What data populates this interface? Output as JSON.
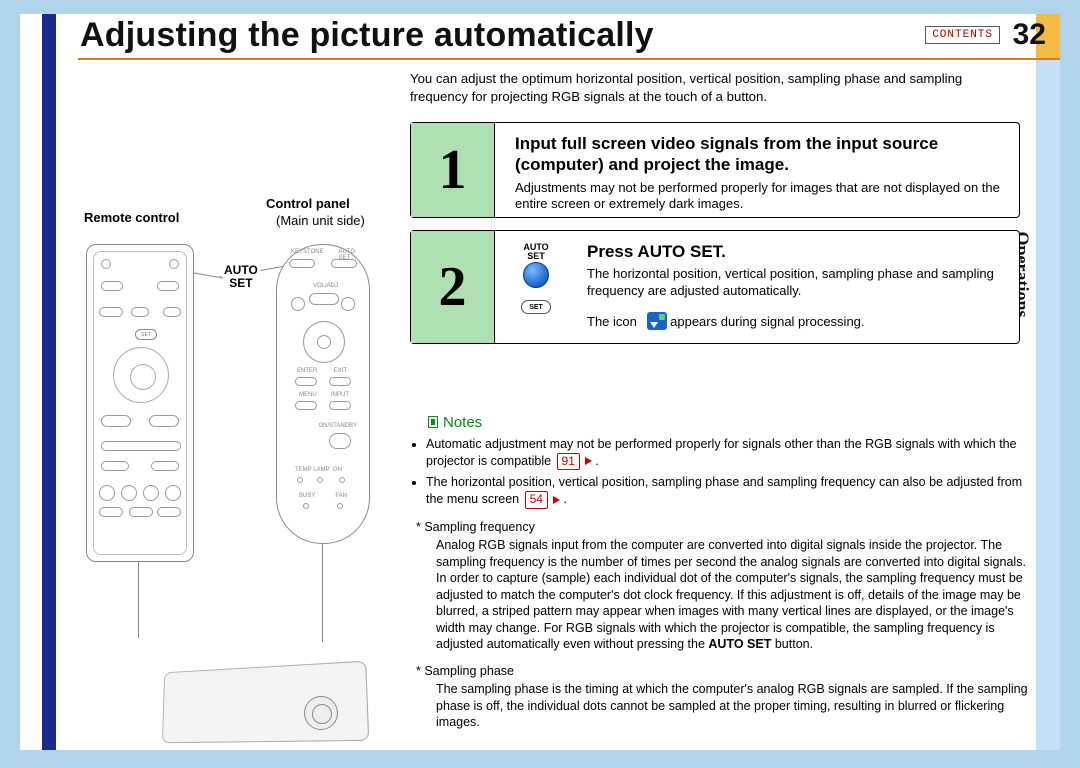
{
  "header": {
    "title": "Adjusting the picture automatically",
    "contents_label": "CONTENTS",
    "page_number": "32",
    "section_tab": "Operations"
  },
  "intro": "You can adjust the optimum horizontal position, vertical position, sampling phase and sampling frequency for projecting RGB signals at the touch of a button.",
  "left_column": {
    "remote_label": "Remote control",
    "control_panel_label": "Control panel",
    "control_panel_sub": "(Main unit side)",
    "auto_set_label_line1": "AUTO",
    "auto_set_label_line2": "SET",
    "remote_set_button": "SET"
  },
  "steps": [
    {
      "number": "1",
      "title": "Input full screen video signals from the input source (computer) and project the image.",
      "body": "Adjustments may not be performed properly for images that are not displayed on the entire screen or extremely dark images."
    },
    {
      "number": "2",
      "title": "Press AUTO SET.",
      "body_line1": "The horizontal position, vertical position, sampling phase and sampling frequency are adjusted automatically.",
      "body_line2_a": "The icon",
      "body_line2_b": "appears during signal processing.",
      "icon_label_top_line1": "AUTO",
      "icon_label_top_line2": "SET",
      "set_pill_label": "SET"
    }
  ],
  "notes": {
    "heading": "Notes",
    "bullets": [
      {
        "text_a": "Automatic adjustment may not be performed properly for signals other than the RGB signals with which the projector is compatible",
        "ref": "91",
        "text_b": "."
      },
      {
        "text_a": "The horizontal position, vertical position, sampling phase and sampling frequency can also be adjusted from the menu screen",
        "ref": "54",
        "text_b": "."
      }
    ],
    "sampling_frequency": {
      "head": "Sampling frequency",
      "body": "Analog RGB signals input from the computer are converted into digital signals inside the projector. The sampling frequency is the number of times per second the analog signals are converted into digital signals. In order to capture (sample) each individual dot of the computer's signals, the sampling frequency must be adjusted to match the computer's dot clock frequency. If this adjustment is off, details of the image may be blurred, a striped pattern may appear when images with many vertical lines are displayed, or the image's width may change. For RGB signals with which the projector is compatible, the sampling frequency is adjusted automatically even without pressing the ",
      "bold": "AUTO SET",
      "body_end": " button."
    },
    "sampling_phase": {
      "head": "Sampling phase",
      "body": "The sampling phase is the timing at which the computer's analog RGB signals are sampled. If the sampling phase is off, the individual dots cannot be sampled at the proper timing, resulting in blurred or flickering images."
    }
  }
}
